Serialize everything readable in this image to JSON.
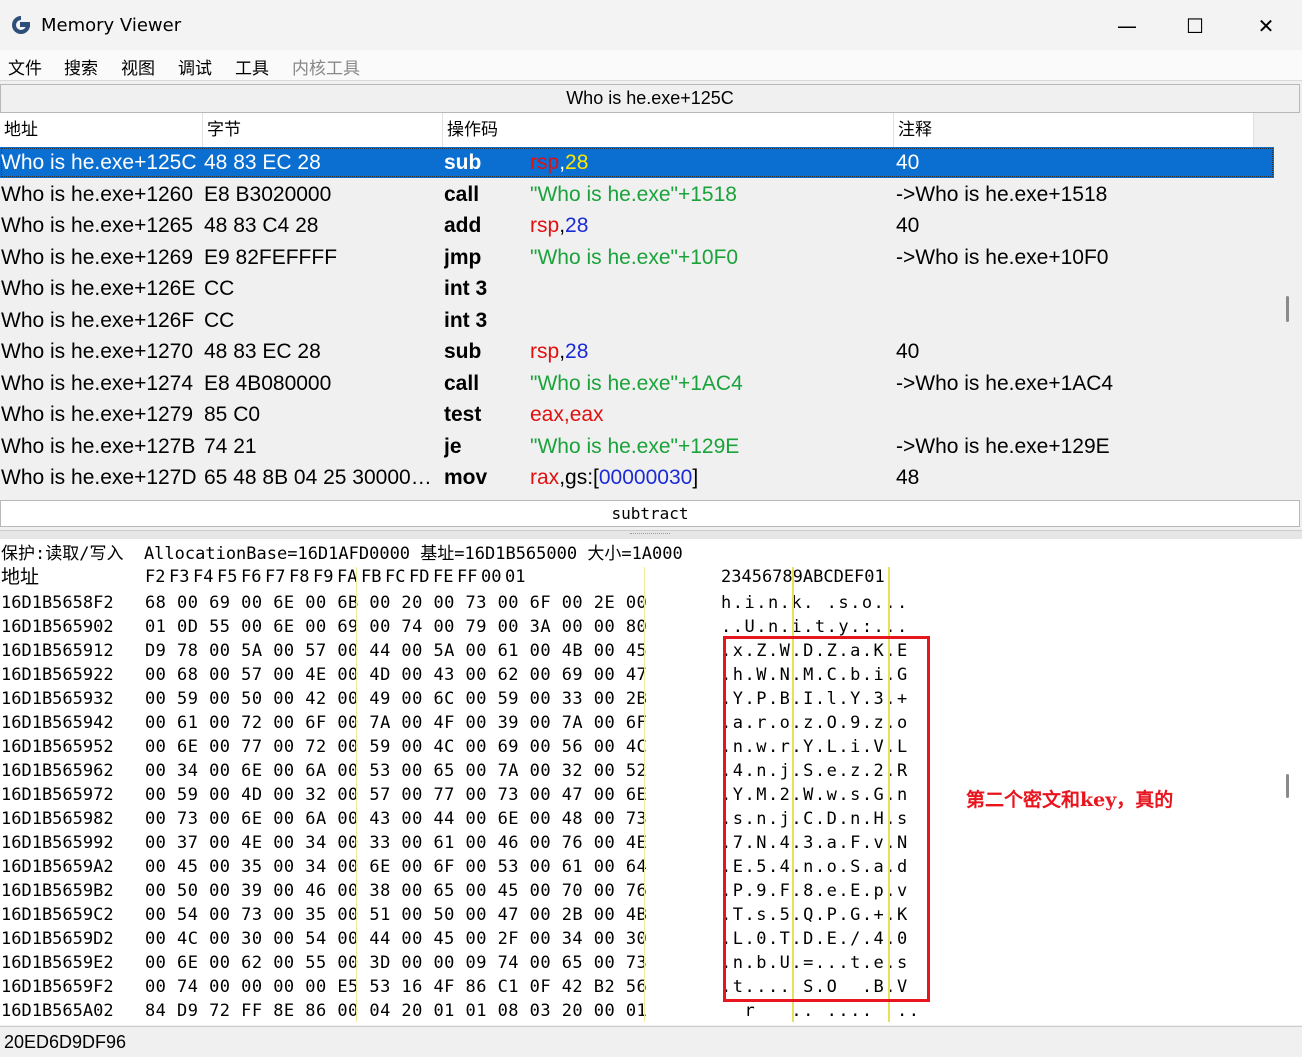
{
  "window": {
    "title": "Memory Viewer",
    "minimize": "—",
    "maximize": "☐",
    "close": "✕"
  },
  "menu": [
    "文件",
    "搜索",
    "视图",
    "调试",
    "工具",
    "内核工具"
  ],
  "disasm": {
    "address_bar": "Who is he.exe+125C",
    "columns": [
      "地址",
      "字节",
      "操作码",
      "注释"
    ],
    "rows": [
      {
        "addr": "Who is he.exe+125C",
        "bytes": "48 83 EC 28",
        "mn": "sub",
        "op": [
          [
            "reg",
            "rsp"
          ],
          [
            "plain",
            ","
          ],
          [
            "num",
            "28"
          ]
        ],
        "comment": "40",
        "selected": true
      },
      {
        "addr": "Who is he.exe+1260",
        "bytes": "E8 B3020000",
        "mn": "call",
        "op": [
          [
            "str",
            "\"Who is he.exe\"+1518"
          ]
        ],
        "comment": "->Who is he.exe+1518"
      },
      {
        "addr": "Who is he.exe+1265",
        "bytes": "48 83 C4 28",
        "mn": "add",
        "op": [
          [
            "reg",
            "rsp"
          ],
          [
            "plain",
            ","
          ],
          [
            "num",
            "28"
          ]
        ],
        "comment": "40"
      },
      {
        "addr": "Who is he.exe+1269",
        "bytes": "E9 82FEFFFF",
        "mn": "jmp",
        "op": [
          [
            "str",
            "\"Who is he.exe\"+10F0"
          ]
        ],
        "comment": "->Who is he.exe+10F0"
      },
      {
        "addr": "Who is he.exe+126E",
        "bytes": "CC",
        "mn": "int 3",
        "op": [],
        "comment": ""
      },
      {
        "addr": "Who is he.exe+126F",
        "bytes": "CC",
        "mn": "int 3",
        "op": [],
        "comment": ""
      },
      {
        "addr": "Who is he.exe+1270",
        "bytes": "48 83 EC 28",
        "mn": "sub",
        "op": [
          [
            "reg",
            "rsp"
          ],
          [
            "plain",
            ","
          ],
          [
            "num",
            "28"
          ]
        ],
        "comment": "40"
      },
      {
        "addr": "Who is he.exe+1274",
        "bytes": "E8 4B080000",
        "mn": "call",
        "op": [
          [
            "str",
            "\"Who is he.exe\"+1AC4"
          ]
        ],
        "comment": "->Who is he.exe+1AC4"
      },
      {
        "addr": "Who is he.exe+1279",
        "bytes": "85 C0",
        "mn": "test",
        "op": [
          [
            "reg",
            "eax"
          ],
          [
            "reg",
            ","
          ],
          [
            "reg",
            "eax"
          ]
        ],
        "comment": ""
      },
      {
        "addr": "Who is he.exe+127B",
        "bytes": "74 21",
        "mn": "je",
        "op": [
          [
            "str",
            "\"Who is he.exe\"+129E"
          ]
        ],
        "comment": "->Who is he.exe+129E"
      },
      {
        "addr": "Who is he.exe+127D",
        "bytes": "65 48 8B 04 25 300000…",
        "mn": "mov",
        "op": [
          [
            "reg",
            "rax"
          ],
          [
            "plain",
            ",gs:["
          ],
          [
            "num",
            "00000030"
          ],
          [
            "plain",
            "]"
          ]
        ],
        "comment": "48"
      }
    ],
    "status": "subtract"
  },
  "hex": {
    "info": "保护:读取/写入  AllocationBase=16D1AFD0000 基址=16D1B565000 大小=1A000",
    "header_label": "地址",
    "header_cols": [
      "F2",
      "F3",
      "F4",
      "F5",
      "F6",
      "F7",
      "F8",
      "F9",
      "FA",
      "FB",
      "FC",
      "FD",
      "FE",
      "FF",
      "00",
      "01"
    ],
    "header_ascii": "23456789ABCDEF01",
    "rows": [
      {
        "addr": "16D1B5658F2",
        "bytes": "68 00 69 00 6E 00 6B 00 20 00 73 00 6F 00 2E 00",
        "ascii": "h.i.n.k. .s.o..."
      },
      {
        "addr": "16D1B565902",
        "bytes": "01 0D 55 00 6E 00 69 00 74 00 79 00 3A 00 00 80",
        "ascii": "..U.n.i.t.y.:..."
      },
      {
        "addr": "16D1B565912",
        "bytes": "D9 78 00 5A 00 57 00 44 00 5A 00 61 00 4B 00 45",
        "ascii": ".x.Z.W.D.Z.a.K.E"
      },
      {
        "addr": "16D1B565922",
        "bytes": "00 68 00 57 00 4E 00 4D 00 43 00 62 00 69 00 47",
        "ascii": ".h.W.N.M.C.b.i.G"
      },
      {
        "addr": "16D1B565932",
        "bytes": "00 59 00 50 00 42 00 49 00 6C 00 59 00 33 00 2B",
        "ascii": ".Y.P.B.I.l.Y.3.+"
      },
      {
        "addr": "16D1B565942",
        "bytes": "00 61 00 72 00 6F 00 7A 00 4F 00 39 00 7A 00 6F",
        "ascii": ".a.r.o.z.O.9.z.o"
      },
      {
        "addr": "16D1B565952",
        "bytes": "00 6E 00 77 00 72 00 59 00 4C 00 69 00 56 00 4C",
        "ascii": ".n.w.r.Y.L.i.V.L"
      },
      {
        "addr": "16D1B565962",
        "bytes": "00 34 00 6E 00 6A 00 53 00 65 00 7A 00 32 00 52",
        "ascii": ".4.n.j.S.e.z.2.R"
      },
      {
        "addr": "16D1B565972",
        "bytes": "00 59 00 4D 00 32 00 57 00 77 00 73 00 47 00 6E",
        "ascii": ".Y.M.2.W.w.s.G.n"
      },
      {
        "addr": "16D1B565982",
        "bytes": "00 73 00 6E 00 6A 00 43 00 44 00 6E 00 48 00 73",
        "ascii": ".s.n.j.C.D.n.H.s"
      },
      {
        "addr": "16D1B565992",
        "bytes": "00 37 00 4E 00 34 00 33 00 61 00 46 00 76 00 4E",
        "ascii": ".7.N.4.3.a.F.v.N"
      },
      {
        "addr": "16D1B5659A2",
        "bytes": "00 45 00 35 00 34 00 6E 00 6F 00 53 00 61 00 64",
        "ascii": ".E.5.4.n.o.S.a.d"
      },
      {
        "addr": "16D1B5659B2",
        "bytes": "00 50 00 39 00 46 00 38 00 65 00 45 00 70 00 76",
        "ascii": ".P.9.F.8.e.E.p.v"
      },
      {
        "addr": "16D1B5659C2",
        "bytes": "00 54 00 73 00 35 00 51 00 50 00 47 00 2B 00 4B",
        "ascii": ".T.s.5.Q.P.G.+.K"
      },
      {
        "addr": "16D1B5659D2",
        "bytes": "00 4C 00 30 00 54 00 44 00 45 00 2F 00 34 00 30",
        "ascii": ".L.0.T.D.E./.4.0"
      },
      {
        "addr": "16D1B5659E2",
        "bytes": "00 6E 00 62 00 55 00 3D 00 00 09 74 00 65 00 73",
        "ascii": ".n.b.U.=...t.e.s"
      },
      {
        "addr": "16D1B5659F2",
        "bytes": "00 74 00 00 00 00 E5 53 16 4F 86 C1 0F 42 B2 56",
        "ascii": ".t.... S.O  .B.V"
      },
      {
        "addr": "16D1B565A02",
        "bytes": "84 D9 72 FF 8E 86 00 04 20 01 01 08 03 20 00 01",
        "ascii": "  r   .. ....  .."
      }
    ]
  },
  "annotation": "第二个密文和key，真的",
  "bottom_status": "20ED6D9DF96",
  "colors": {
    "selection": "#0a6fd1",
    "register": "#e01010",
    "number": "#1a2bd6",
    "string": "#1aa33a",
    "highlight_box": "#e8141e",
    "column_guide": "#e8e05a"
  }
}
